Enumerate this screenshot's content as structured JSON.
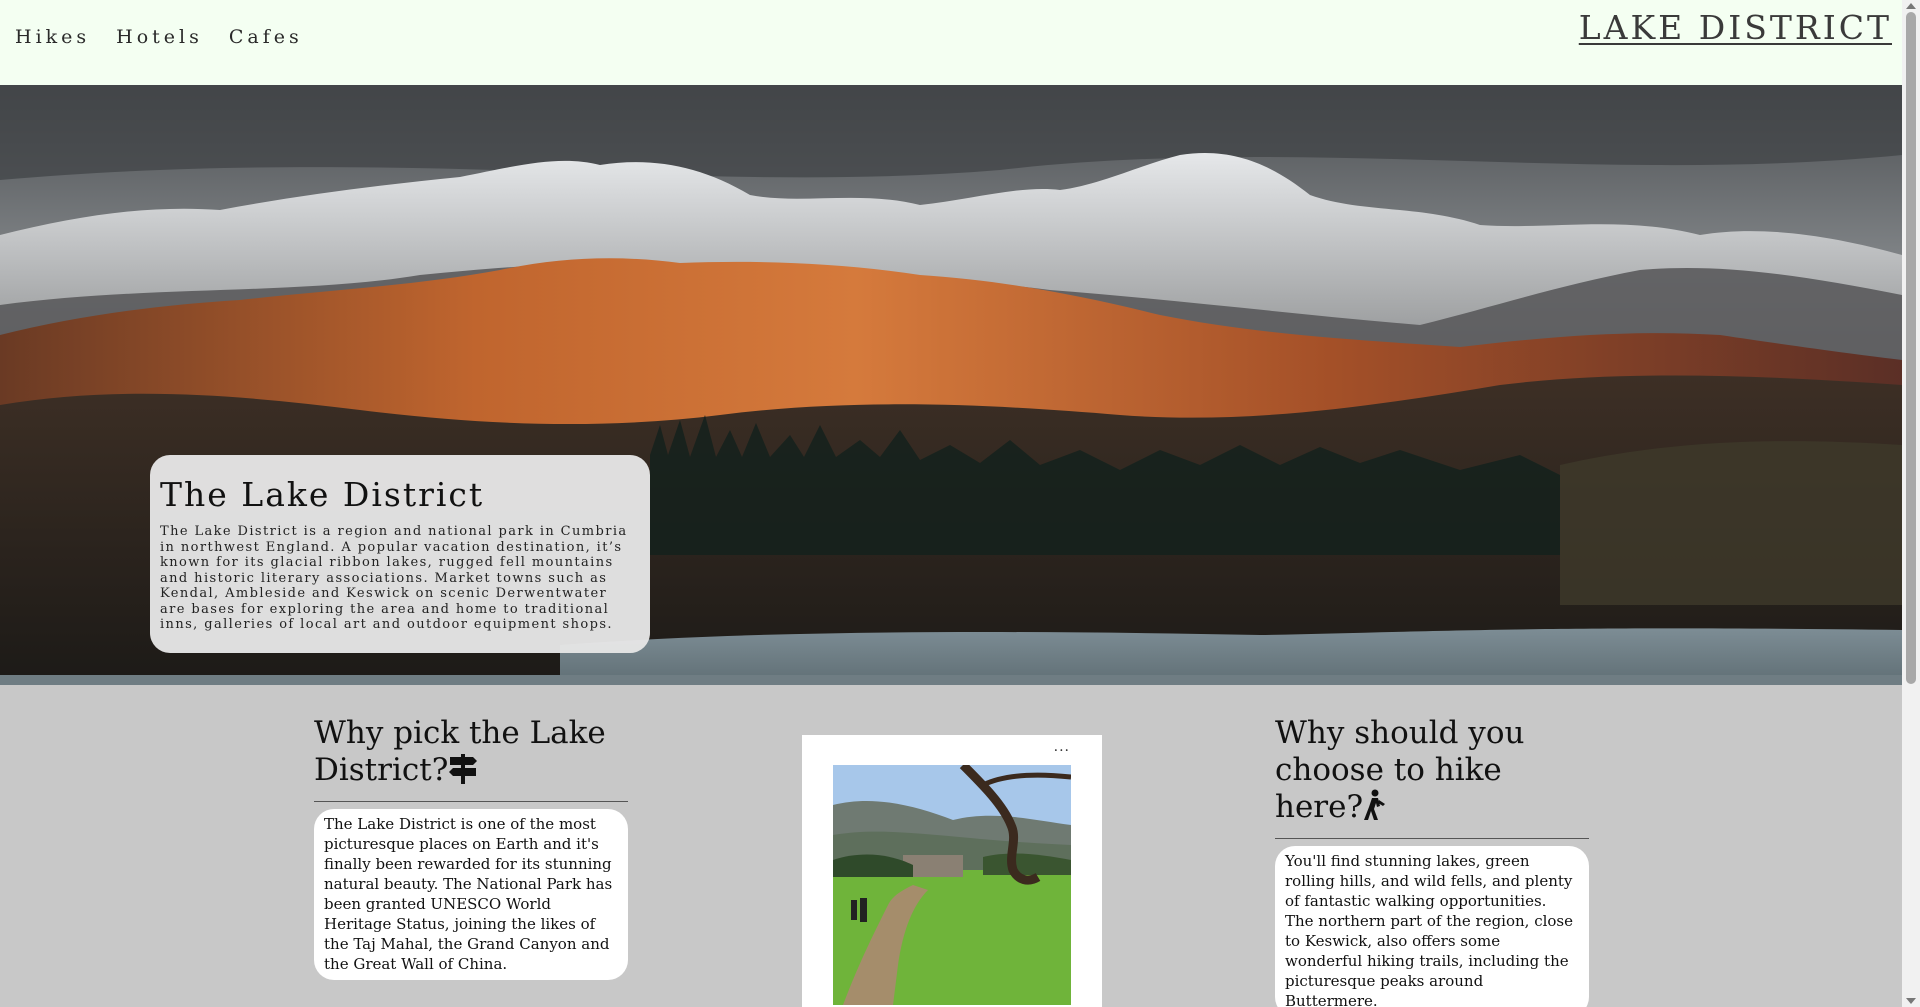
{
  "nav": {
    "links": [
      "Hikes",
      "Hotels",
      "Cafes"
    ],
    "brand": "LAKE DISTRICT"
  },
  "hero": {
    "image_description_icon": "mountain-landscape-image",
    "card": {
      "title": "The Lake District",
      "text": "The Lake District is a region and national park in Cumbria in northwest England. A popular vacation destination, it’s known for its glacial ribbon lakes, rugged fell mountains and historic literary associations. Market towns such as Kendal, Ambleside and Keswick on scenic Derwentwater are bases for exploring the area and home to traditional inns, galleries of local art and outdoor equipment shops."
    }
  },
  "sections": {
    "left": {
      "heading": "Why pick the Lake District?",
      "icon": "signpost-icon",
      "text": "The Lake District is one of the most picturesque places on Earth and it's finally been rewarded for its stunning natural beauty. The National Park has been granted UNESCO World Heritage Status, joining the likes of the Taj Mahal, the Grand Canyon and the Great Wall of China."
    },
    "middle": {
      "more_label": "...",
      "photo_icon": "park-photo"
    },
    "right": {
      "heading": "Why should you choose to hike here?",
      "icon": "hiker-icon",
      "text": "You'll find stunning lakes, green rolling hills, and wild fells, and plenty of fantastic walking opportunities. The northern part of the region, close to Keswick, also offers some wonderful hiking trails, including the picturesque peaks around Buttermere."
    }
  },
  "colors": {
    "header_bg": "#f4fff2",
    "content_bg": "#c8c8c8",
    "card_bg": "#e6e6e6"
  }
}
